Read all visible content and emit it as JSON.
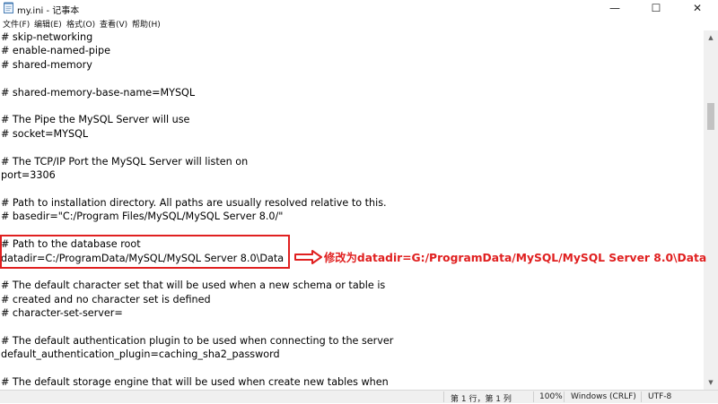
{
  "window": {
    "title": "my.ini - 记事本",
    "minimize_glyph": "—",
    "maximize_glyph": "☐",
    "close_glyph": "✕"
  },
  "menu": {
    "file": "文件(F)",
    "edit": "编辑(E)",
    "format": "格式(O)",
    "view": "查看(V)",
    "help": "帮助(H)"
  },
  "editor": {
    "lines": [
      "# skip-networking",
      "# enable-named-pipe",
      "# shared-memory",
      "",
      "# shared-memory-base-name=MYSQL",
      "",
      "# The Pipe the MySQL Server will use",
      "# socket=MYSQL",
      "",
      "# The TCP/IP Port the MySQL Server will listen on",
      "port=3306",
      "",
      "# Path to installation directory. All paths are usually resolved relative to this.",
      "# basedir=\"C:/Program Files/MySQL/MySQL Server 8.0/\"",
      "",
      "# Path to the database root",
      "datadir=C:/ProgramData/MySQL/MySQL Server 8.0\\Data",
      "",
      "# The default character set that will be used when a new schema or table is",
      "# created and no character set is defined",
      "# character-set-server=",
      "",
      "# The default authentication plugin to be used when connecting to the server",
      "default_authentication_plugin=caching_sha2_password",
      "",
      "# The default storage engine that will be used when create new tables when"
    ]
  },
  "annotation": {
    "text": "修改为datadir=G:/ProgramData/MySQL/MySQL Server 8.0\\Data",
    "color": "#e02020"
  },
  "status": {
    "position": "第 1 行，第 1 列",
    "zoom": "100%",
    "line_ending": "Windows (CRLF)",
    "encoding": "UTF-8"
  },
  "icons": {
    "app": "notepad-icon",
    "scroll_up": "chevron-up-icon",
    "scroll_down": "chevron-down-icon"
  }
}
